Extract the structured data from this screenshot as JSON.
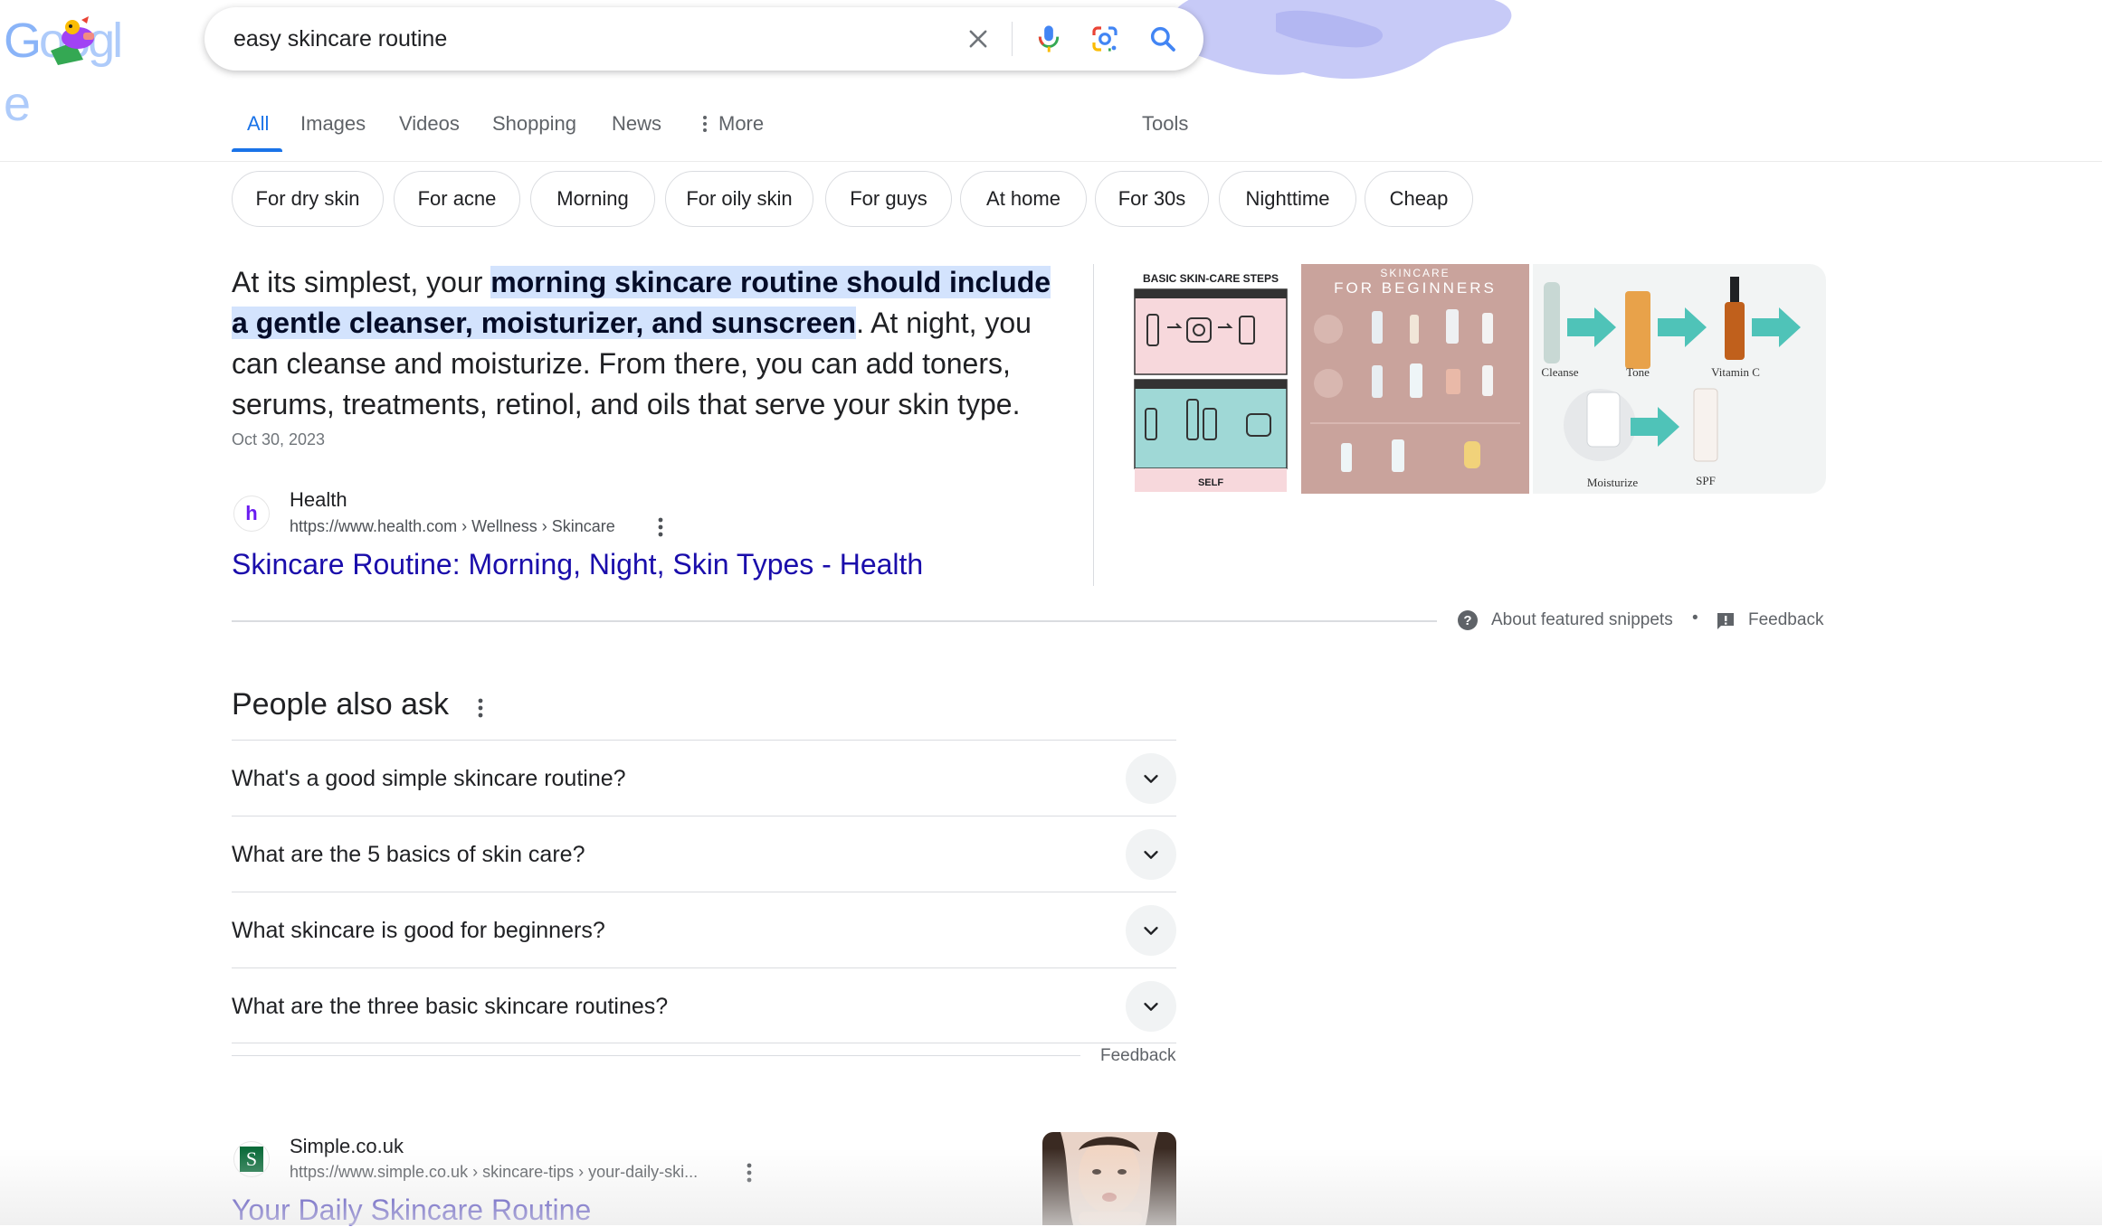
{
  "header": {
    "logo_letters": [
      "G",
      "o",
      "o",
      "g",
      "l",
      "e"
    ],
    "search": {
      "query": "easy skincare routine"
    },
    "icons": {
      "clear": "close-icon",
      "voice": "mic-icon",
      "lens": "lens-icon",
      "search": "search-icon"
    }
  },
  "tabs": [
    {
      "label": "All",
      "active": true
    },
    {
      "label": "Images"
    },
    {
      "label": "Videos"
    },
    {
      "label": "Shopping"
    },
    {
      "label": "News"
    },
    {
      "label": "More"
    }
  ],
  "tools_label": "Tools",
  "chips": [
    "For dry skin",
    "For acne",
    "Morning",
    "For oily skin",
    "For guys",
    "At home",
    "For 30s",
    "Nighttime",
    "Cheap"
  ],
  "featured_snippet": {
    "text_before": "At its simplest, your ",
    "text_highlight": "morning skincare routine should include a gentle cleanser, moisturizer, and sunscreen",
    "text_after": ". At night, you can cleanse and moisturize. From there, you can add toners, serums, treatments, retinol, and oils that serve your skin type.",
    "date": "Oct 30, 2023",
    "source": {
      "favicon_letter": "h",
      "name": "Health",
      "url": "https://www.health.com › Wellness › Skincare",
      "title": "Skincare Routine: Morning, Night, Skin Types - Health"
    },
    "images": [
      {
        "heading": "BASIC SKIN-CARE STEPS",
        "footer": "SELF"
      },
      {
        "heading_line1": "SKINCARE",
        "heading_line2": "FOR BEGINNERS"
      },
      {
        "labels": [
          "Cleanse",
          "Tone",
          "Vitamin C",
          "Moisturize",
          "SPF"
        ]
      }
    ],
    "footer": {
      "about": "About featured snippets",
      "separator": "•",
      "feedback": "Feedback"
    }
  },
  "people_also_ask": {
    "title": "People also ask",
    "questions": [
      "What's a good simple skincare routine?",
      "What are the 5 basics of skin care?",
      "What skincare is good for beginners?",
      "What are the three basic skincare routines?"
    ],
    "feedback": "Feedback"
  },
  "result2": {
    "favicon_letter": "S",
    "name": "Simple.co.uk",
    "url": "https://www.simple.co.uk › skincare-tips › your-daily-ski...",
    "title": "Your Daily Skincare Routine"
  },
  "colors": {
    "link": "#1a0dab",
    "accent": "#1a73e8",
    "highlight": "#d3e3fd"
  }
}
